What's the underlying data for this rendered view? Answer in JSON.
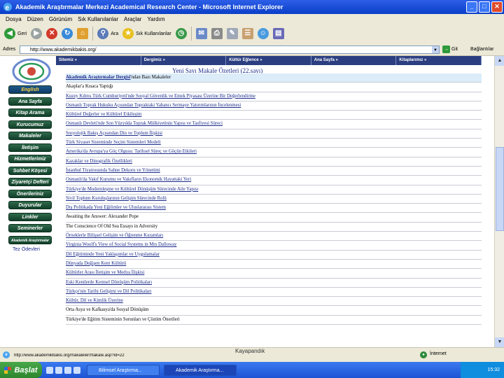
{
  "window": {
    "title": "Akademik Araştırmalar Merkezi Academical Research Center - Microsoft Internet Explorer",
    "buttons": {
      "minimize": "_",
      "maximize": "□",
      "close": "✕"
    }
  },
  "menu": [
    "Dosya",
    "Düzen",
    "Görünüm",
    "Sık Kullanılanlar",
    "Araçlar",
    "Yardım"
  ],
  "toolbar": {
    "back": "Geri",
    "search": "Ara",
    "favorites": "Sık Kullanılanlar"
  },
  "address": {
    "label": "Adres",
    "url": "http://www.akademikbakis.org/",
    "go": "Git",
    "links": "Bağlantılar"
  },
  "nav": [
    "Sitemiz »",
    "Dergimiz »",
    "Kültür Eğlence »",
    "Ana Sayfa »",
    "Kitaplarımız »"
  ],
  "sidebar": [
    "English",
    "Ana Sayfa",
    "Kitap Arama",
    "Kurucumuz",
    "Makaleler",
    "İletişim",
    "Hizmetlerimiz",
    "Sohbet Köşesi",
    "Ziyaretçi Defteri",
    "Önerileriniz",
    "Duyurular",
    "Linkler",
    "Seminerler",
    "Akademik Araştırmalar Merkezi"
  ],
  "sidebar_note": "Tez Ödevleri",
  "heading": "Yeni Sayı Makale Özetleri (22.sayı)",
  "articles": [
    {
      "text": "Akademik Araştırmalar Dergisi",
      "suffix": "'ndan Bazı Makaleler",
      "style": "hl"
    },
    {
      "text": "Akaplar'a Kısaca Yaptığı",
      "style": "plain"
    },
    {
      "text": "Kuzey Kıbrıs Türk Cumhuriyeti'nde Sosyal Güvenlik ve Emek Piyasası Üzerine Bir Değerlendirme",
      "style": "link"
    },
    {
      "text": "Osmanlı Toprak Hukuku Açısından Topraktaki Yabancı Sermaye Yatırımlarının İncelenmesi",
      "style": "link"
    },
    {
      "text": "Kültürel Değerler ve Kültürel Etkileşim",
      "style": "link"
    },
    {
      "text": "Osmanlı Devleti'nde Son Yüzyılda Toprak Mülkiyetinin Yapısı ve Tasfiyesi Süreci",
      "style": "link"
    },
    {
      "text": "Sosyolojik Bakış Açısından Din ve Toplum İlişkisi",
      "style": "link"
    },
    {
      "text": "Türk Siyaset Sisteminde Seçim Sistemleri Modeli",
      "style": "link"
    },
    {
      "text": "Amerika'da Avrupa'ya Göç Olgusu: Tarihsel Süreç ve Göçün Etkileri",
      "style": "link"
    },
    {
      "text": "Kazaklar ve Dinografik Özellikleri",
      "style": "link"
    },
    {
      "text": "İstanbul Tiyatrosunda Sahne Dekoru ve Yönetimi",
      "style": "link"
    },
    {
      "text": "Osmanlı'da Vakıf Kurumu ve Vakıfların Ekonomik Hayattaki Yeri",
      "style": "link"
    },
    {
      "text": "Türkiye'de Modernleşme ve Kültürel Dönüşüm Sürecinde Aile Yapısı",
      "style": "link"
    },
    {
      "text": "Sivil Toplum Kuruluşlarının Gelişim Sürecinde Rolü",
      "style": "link"
    },
    {
      "text": "Dış Politikada Yeni Eğilimler ve Uluslararası Sistem",
      "style": "link"
    },
    {
      "text": "Awaiting the Answer: Alexander Pope",
      "style": "plain"
    },
    {
      "text": "The Conscience Of Old Sea Essays in Adversity",
      "style": "plain"
    },
    {
      "text": "Örneklerle Bilişsel Gelişim ve Öğrenme Kuramları",
      "style": "link"
    },
    {
      "text": "Virginia Woolf's View of Social Systems in Mrs Dalloway",
      "style": "link"
    },
    {
      "text": "Dil Eğitiminde Yeni Yaklaşımlar ve Uygulamalar",
      "style": "link"
    },
    {
      "text": "Dünyada Değişen Kent Kültürü",
      "style": "link"
    },
    {
      "text": "Kültürler Arası İletişim ve Medya İlişkisi",
      "style": "link"
    },
    {
      "text": "Eski Kentlerde Kentsel Dönüşüm Politikaları",
      "style": "link"
    },
    {
      "text": "Türkçe'nin Tarihi Gelişimi ve Dil Politikaları",
      "style": "link"
    },
    {
      "text": "Kültür, Dil ve Kimlik Üzerine",
      "style": "link"
    },
    {
      "text": "Orta Asya ve Kafkasya'da Sosyal Dönüşüm",
      "style": "plain"
    },
    {
      "text": "Türkiye'de Eğitim Sisteminin Sorunları ve Çözüm Önerileri",
      "style": "plain"
    }
  ],
  "status": {
    "text": "http://www.akademikbakis.org/makaleler/makale.asp?id=22",
    "zone": "İnternet"
  },
  "caption": "Kayapandık",
  "taskbar": {
    "start": "Başlat",
    "tasks": [
      "Bilimsel Araştırma...",
      "Akademik Araştırma..."
    ],
    "clock": "15:32"
  }
}
